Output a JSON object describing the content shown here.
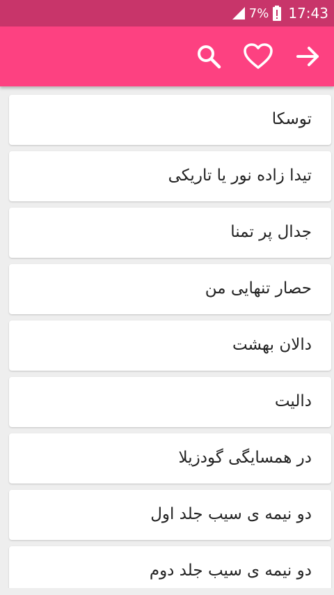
{
  "status_bar": {
    "battery_percent": "7%",
    "time": "17:43",
    "icons": [
      "signal-icon",
      "battery-alert-icon"
    ]
  },
  "toolbar": {
    "background": "#fd4181",
    "icons": [
      "search-icon",
      "heart-icon",
      "arrow-forward-icon"
    ]
  },
  "list": {
    "items": [
      {
        "title": "توسکا"
      },
      {
        "title": "تیدا زاده نور یا تاریکی"
      },
      {
        "title": "جدال پر تمنا"
      },
      {
        "title": "حصار تنهایی من"
      },
      {
        "title": "دالان بهشت"
      },
      {
        "title": "دالیت"
      },
      {
        "title": "در همسایگی گودزیلا"
      },
      {
        "title": "دو نیمه ی سیب جلد اول"
      },
      {
        "title": "دو نیمه ی سیب جلد دوم"
      }
    ]
  }
}
